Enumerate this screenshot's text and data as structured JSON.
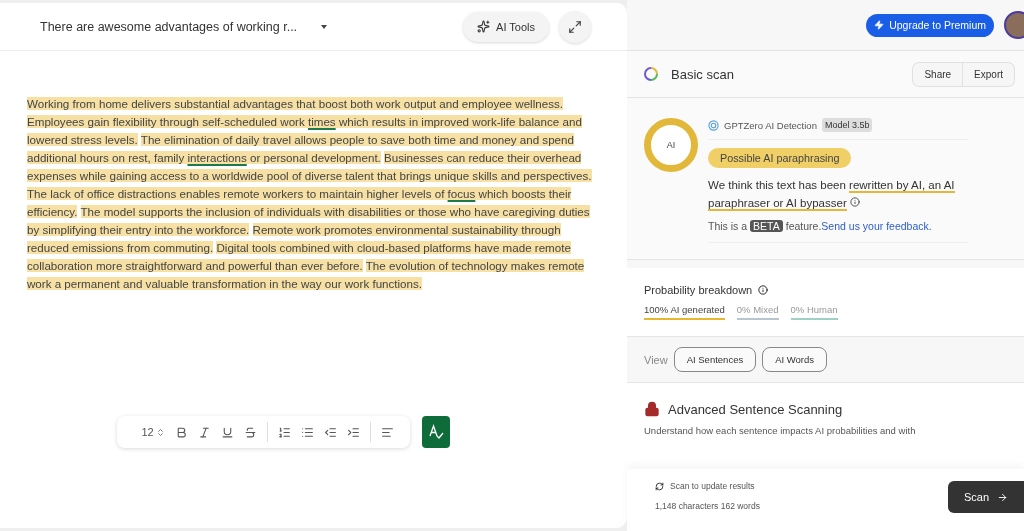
{
  "editor": {
    "title": "There are awesome advantages of working r...",
    "ai_tools": "AI Tools",
    "sentences": [
      {
        "highlighted": true,
        "parts": [
          {
            "text": "Working from home delivers substantial advantages that boost both work output and employee wellness.",
            "underlined": false
          }
        ]
      },
      {
        "highlighted": true,
        "parts": [
          {
            "text": "Employees gain flexibility through self-scheduled work ",
            "underlined": false
          },
          {
            "text": "times",
            "underlined": true
          },
          {
            "text": " which results in improved work-life balance and lowered stress levels.",
            "underlined": false
          }
        ]
      },
      {
        "highlighted": true,
        "parts": [
          {
            "text": "The elimination of daily travel allows people to save both time and money and spend additional hours on rest, family ",
            "underlined": false
          },
          {
            "text": "interactions",
            "underlined": true
          },
          {
            "text": " or personal development.",
            "underlined": false
          }
        ]
      },
      {
        "highlighted": true,
        "parts": [
          {
            "text": "Businesses can reduce their overhead expenses while gaining access to a worldwide pool of diverse talent that brings unique skills and perspectives.",
            "underlined": false
          }
        ]
      },
      {
        "highlighted": true,
        "parts": [
          {
            "text": "The lack of office distractions enables remote workers to maintain higher levels of ",
            "underlined": false
          },
          {
            "text": "focus",
            "underlined": true
          },
          {
            "text": " which boosts their efficiency.",
            "underlined": false
          }
        ]
      },
      {
        "highlighted": true,
        "parts": [
          {
            "text": "The model supports the inclusion of individuals with disabilities or those who have caregiving duties by simplifying their entry into the workforce.",
            "underlined": false
          }
        ]
      },
      {
        "highlighted": true,
        "parts": [
          {
            "text": "Remote work promotes environmental sustainability through reduced emissions from commuting.",
            "underlined": false
          }
        ]
      },
      {
        "highlighted": true,
        "parts": [
          {
            "text": "Digital tools combined with cloud-based platforms have made remote collaboration more straightforward and powerful than ever before.",
            "underlined": false
          }
        ]
      },
      {
        "highlighted": true,
        "parts": [
          {
            "text": "The evolution of technology makes remote work a permanent and valuable transformation in the way our work functions.",
            "underlined": false
          }
        ]
      }
    ],
    "font_size": "12"
  },
  "panel": {
    "upgrade": "Upgrade to Premium",
    "scan_title": "Basic scan",
    "share": "Share",
    "export": "Export",
    "score_label": "AI",
    "detector": "GPTZero AI Detection",
    "model": "Model 3.5b",
    "verdict": "Possible AI paraphrasing",
    "explanation_lead": "We think this text has been ",
    "explanation_link": "rewritten by AI, an AI paraphraser or AI bypasser",
    "beta_lead": "This is a",
    "beta": "BETA",
    "beta_tail": "feature.",
    "feedback": "Send us your feedback.",
    "breakdown_title": "Probability breakdown",
    "breakdown": [
      {
        "label": "100% AI generated",
        "color": "#e8b830",
        "selected": true
      },
      {
        "label": "0% Mixed",
        "color": "#b8c4d0",
        "selected": false
      },
      {
        "label": "0% Human",
        "color": "#9fd0c8",
        "selected": false
      }
    ],
    "view_label": "View",
    "views": [
      {
        "label": "AI Sentences"
      },
      {
        "label": "AI Words"
      }
    ],
    "advanced_title": "Advanced Sentence Scanning",
    "advanced_text": "Understand how each sentence impacts AI probabilities and with",
    "scan_hint": "Scan to update results",
    "counts": "1,148 characters 162 words",
    "scan": "Scan"
  }
}
